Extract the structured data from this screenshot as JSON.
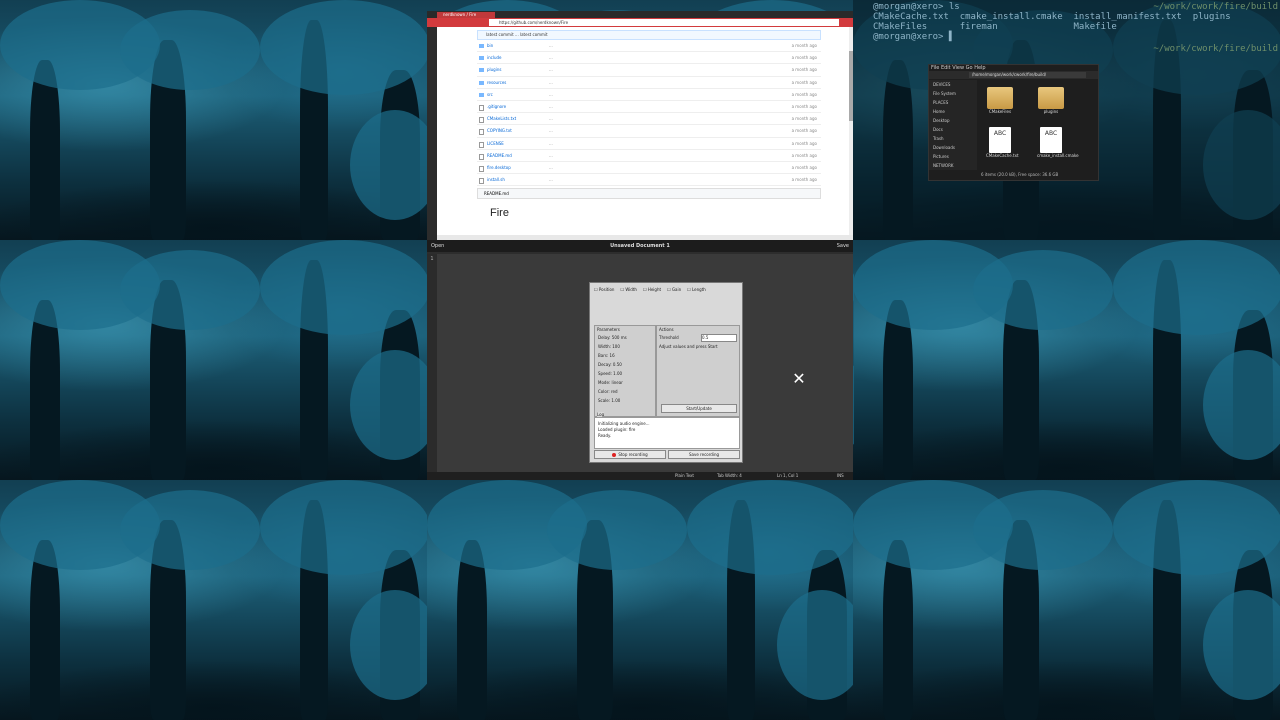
{
  "browser": {
    "tab_title": "nerdknown / Fire",
    "url": "https://github.com/nerdknown/Fire",
    "repo_header": "latest commit  ...  latest commit",
    "readme_label": "README.md",
    "page_heading": "Fire",
    "rows": [
      {
        "name": "bin",
        "msg": "...",
        "ago": "a month ago",
        "type": "dir"
      },
      {
        "name": "include",
        "msg": "...",
        "ago": "a month ago",
        "type": "dir"
      },
      {
        "name": "plugins",
        "msg": "...",
        "ago": "a month ago",
        "type": "dir"
      },
      {
        "name": "resources",
        "msg": "...",
        "ago": "a month ago",
        "type": "dir"
      },
      {
        "name": "src",
        "msg": "...",
        "ago": "a month ago",
        "type": "dir"
      },
      {
        "name": ".gitignore",
        "msg": "...",
        "ago": "a month ago",
        "type": "file"
      },
      {
        "name": "CMakeLists.txt",
        "msg": "...",
        "ago": "a month ago",
        "type": "file"
      },
      {
        "name": "COPYING.txt",
        "msg": "...",
        "ago": "a month ago",
        "type": "file"
      },
      {
        "name": "LICENSE",
        "msg": "...",
        "ago": "a month ago",
        "type": "file"
      },
      {
        "name": "README.md",
        "msg": "...",
        "ago": "a month ago",
        "type": "file"
      },
      {
        "name": "fire.desktop",
        "msg": "...",
        "ago": "a month ago",
        "type": "file"
      },
      {
        "name": "install.sh",
        "msg": "...",
        "ago": "a month ago",
        "type": "file"
      }
    ]
  },
  "terminal": {
    "lines": [
      "@morgan@xero> ls",
      "CMakeCache.txt  cmake_install.cmake  install_manifest.txt  plugins",
      "CMakeFiles      fireman              Makefile",
      "@morgan@xero> ▌"
    ],
    "right_lines": [
      "~/work/cwork/fire/build",
      "",
      "~/work/cwork/fire/build"
    ]
  },
  "file_manager": {
    "menu": "File  Edit  View  Go  Help",
    "path": "/home/morgan/work/cwork/fire/build/",
    "devices_label": "DEVICES",
    "places_label": "PLACES",
    "network_label": "NETWORK",
    "side_items": [
      "File System",
      "Home",
      "Desktop",
      "Docs",
      "Trash",
      "Downloads",
      "Pictures"
    ],
    "items": [
      {
        "name": "CMakeFiles",
        "kind": "folder"
      },
      {
        "name": "plugins",
        "kind": "folder"
      },
      {
        "name": "CMakeCache.txt",
        "kind": "doc"
      },
      {
        "name": "cmake_install.cmake",
        "kind": "doc"
      }
    ],
    "status": "6 items (20.0 kB), Free space: 36.6 GB"
  },
  "editor": {
    "menu": "Open",
    "title": "Unsaved Document 1",
    "save": "Save",
    "line_no": "1",
    "status": [
      "Plain Text",
      "Tab Width: 4",
      "Ln 1, Col 1",
      "INS"
    ]
  },
  "dialog": {
    "options": [
      "Position",
      "Width",
      "Height",
      "Gain",
      "Length"
    ],
    "left_group_title": "Parameters",
    "right_group_title": "Actions",
    "left_items": [
      "Delay: 500 ms",
      "Width: 100",
      "Bars: 16",
      "Decay: 0.50",
      "Speed: 1.00",
      "Mode: linear",
      "Color: red",
      "Scale: 1.00"
    ],
    "right_input_label": "Threshold",
    "right_input_value": "0.5",
    "right_note": "Adjust values and press Start",
    "right_button": "Start/Update",
    "log_title": "Log",
    "log_lines": [
      "Initializing audio engine...",
      "Loaded plugin: fire",
      "Ready."
    ],
    "btn_stop": "Stop recording",
    "btn_save": "Save recording"
  },
  "close_icon_glyph": "✕"
}
